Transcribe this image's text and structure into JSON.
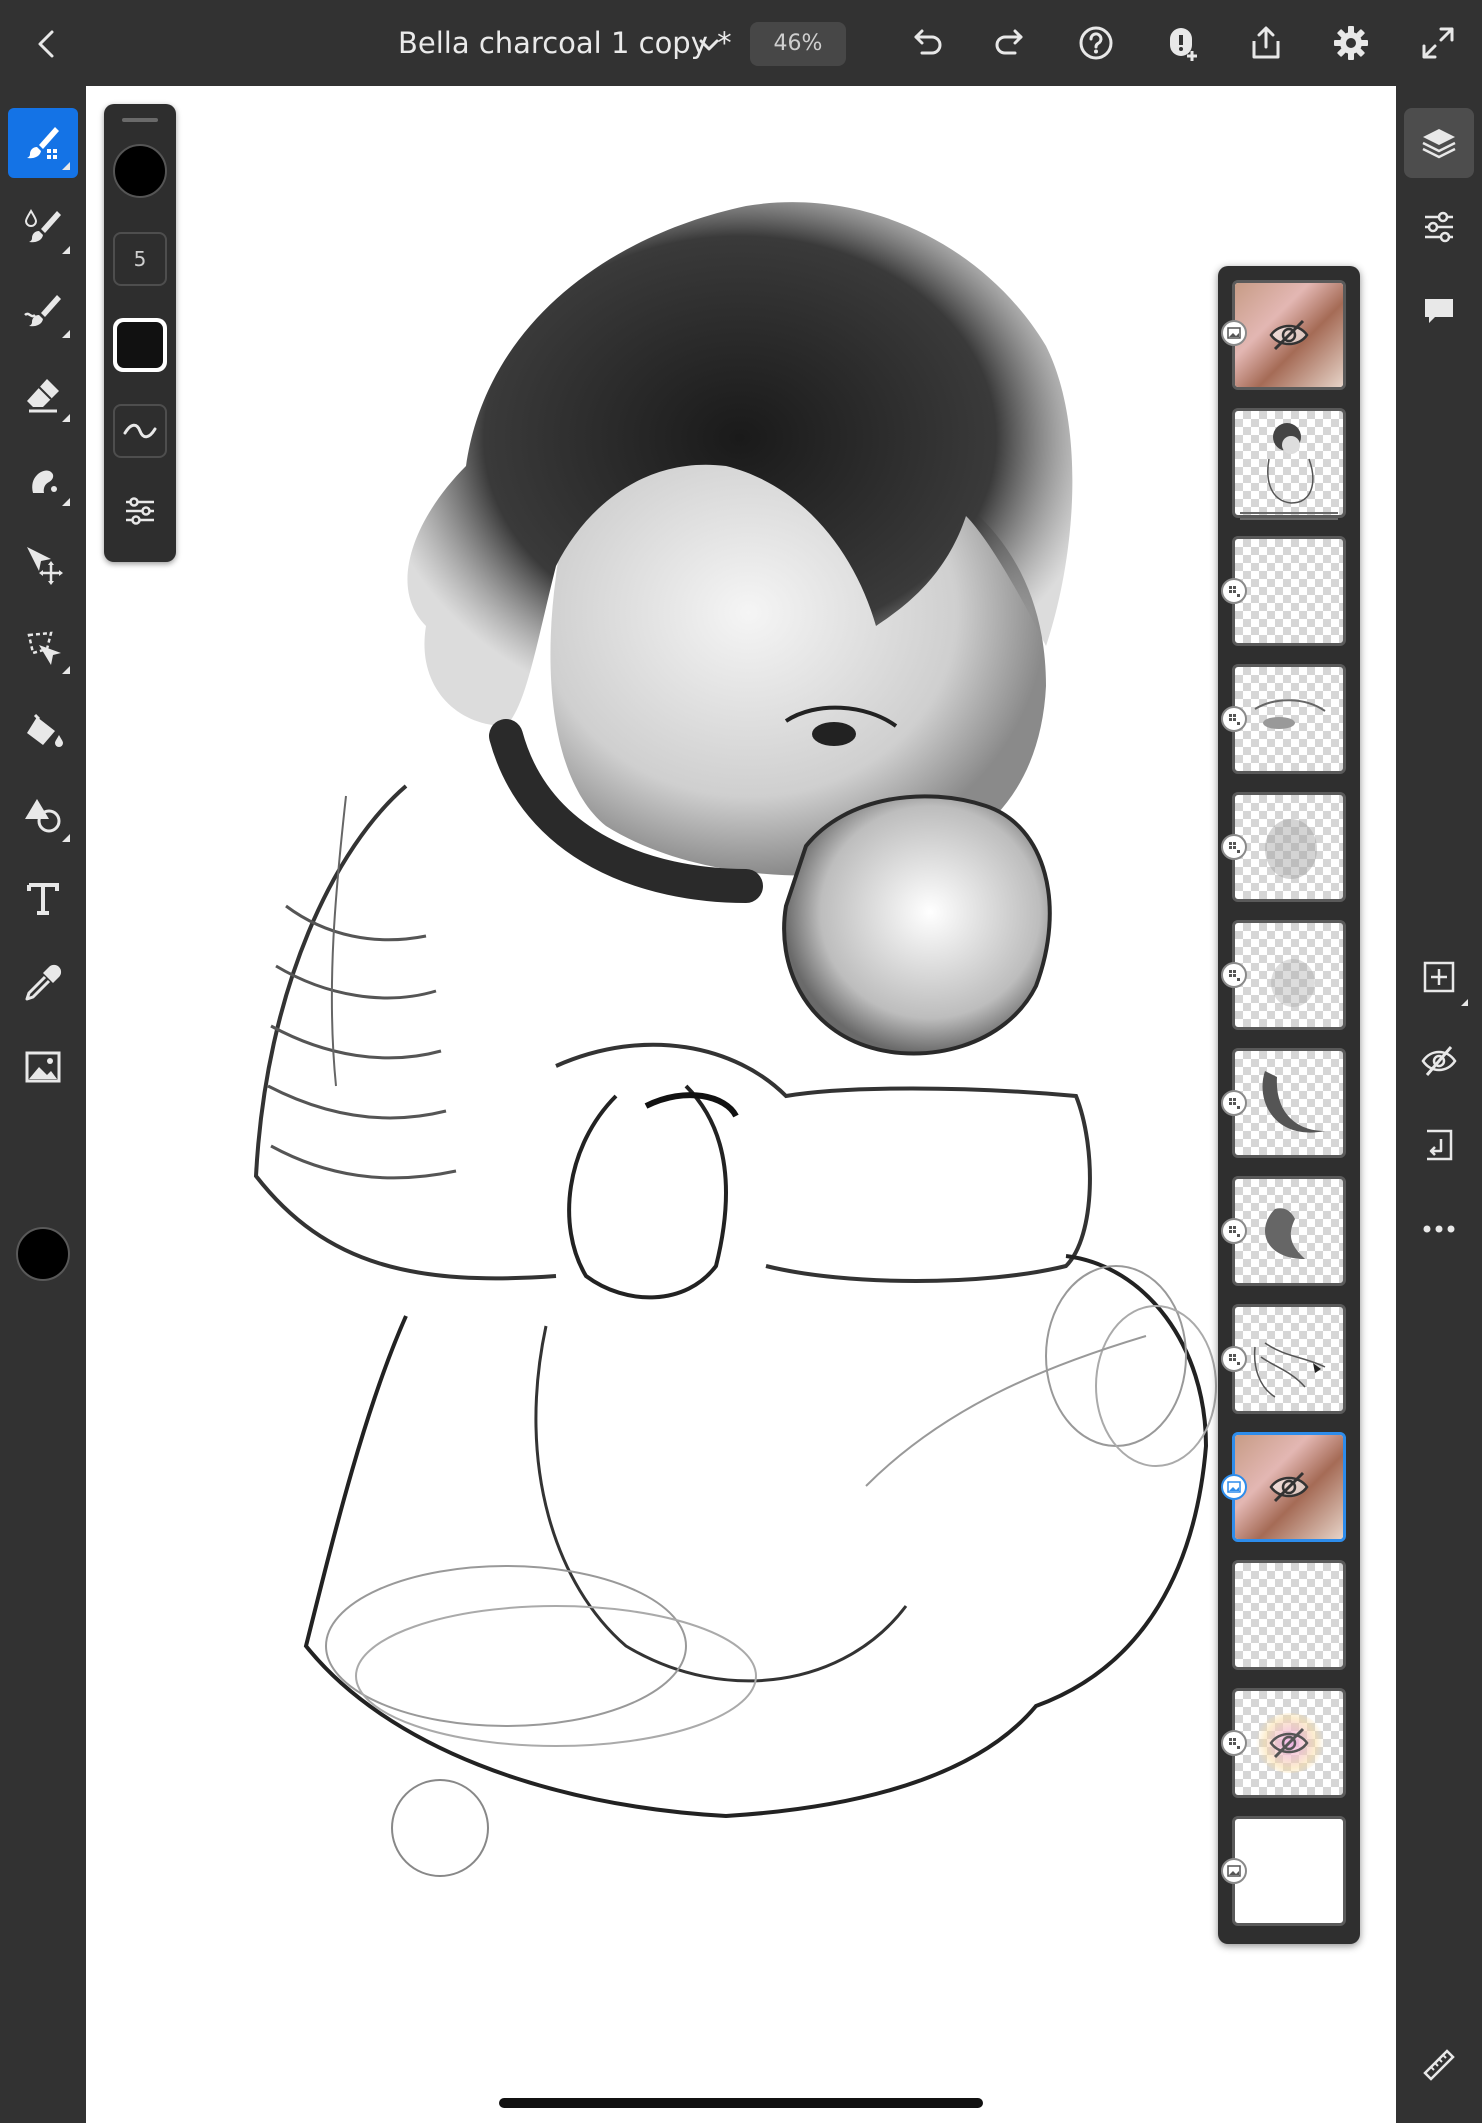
{
  "header": {
    "document_title": "Bella charcoal 1 copy *",
    "zoom": "46%"
  },
  "brush_panel": {
    "size_value": "5"
  },
  "left_toolbar": {
    "tools": [
      "brush-select-icon",
      "paint-brush-icon",
      "smudge-icon",
      "eraser-icon",
      "liquify-icon",
      "move-icon",
      "lasso-icon",
      "fill-icon",
      "shape-icon",
      "text-icon",
      "eyedropper-icon",
      "image-icon"
    ],
    "active_tool": "brush-select-icon",
    "current_color": "#000000"
  },
  "layers": {
    "count": 13,
    "selected_index": 9
  },
  "colors": {
    "accent": "#1473e6",
    "selection": "#2d8ceb",
    "chrome": "#323232"
  }
}
